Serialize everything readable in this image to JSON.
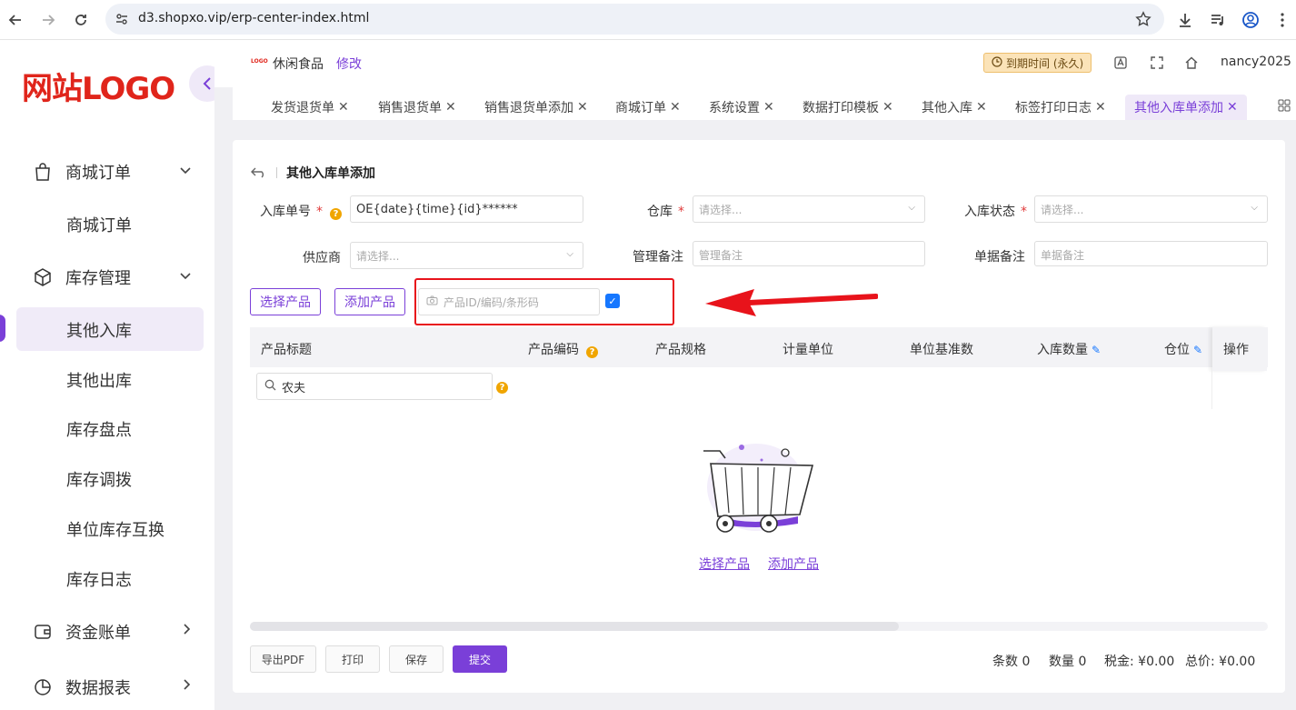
{
  "browser": {
    "url": "d3.shopxo.vip/erp-center-index.html"
  },
  "sidebar": {
    "logo": "网站LOGO",
    "groups": [
      {
        "label": "商城订单",
        "icon": "shopping-bag-icon"
      },
      {
        "label": "库存管理",
        "icon": "cube-icon"
      },
      {
        "label": "资金账单",
        "icon": "wallet-icon"
      },
      {
        "label": "数据报表",
        "icon": "pie-chart-icon"
      }
    ],
    "items": [
      "商城订单",
      "其他入库",
      "其他出库",
      "库存盘点",
      "库存调拨",
      "单位库存互换",
      "库存日志"
    ]
  },
  "header": {
    "logo_text": "LOGO",
    "shop_name": "休闲食品",
    "edit_label": "修改",
    "expire_label": "到期时间 (永久)",
    "user": "nancy2025"
  },
  "tabs": [
    {
      "label": "发货退货单"
    },
    {
      "label": "销售退货单"
    },
    {
      "label": "销售退货单添加"
    },
    {
      "label": "商城订单"
    },
    {
      "label": "系统设置"
    },
    {
      "label": "数据打印模板"
    },
    {
      "label": "其他入库"
    },
    {
      "label": "标签打印日志"
    },
    {
      "label": "其他入库单添加"
    }
  ],
  "form": {
    "title": "其他入库单添加",
    "order_no_label": "入库单号",
    "order_no_value": "OE{date}{time}{id}******",
    "warehouse_label": "仓库",
    "warehouse_placeholder": "请选择...",
    "status_label": "入库状态",
    "status_placeholder": "请选择...",
    "supplier_label": "供应商",
    "supplier_placeholder": "请选择...",
    "manage_note_label": "管理备注",
    "manage_note_placeholder": "管理备注",
    "doc_note_label": "单据备注",
    "doc_note_placeholder": "单据备注",
    "select_product": "选择产品",
    "add_product": "添加产品",
    "scan_placeholder": "产品ID/编码/条形码",
    "checkbox_checked": true
  },
  "table": {
    "columns": [
      "产品标题",
      "产品编码",
      "产品规格",
      "计量单位",
      "单位基准数",
      "入库数量",
      "仓位",
      "操作"
    ],
    "search_value": "农夫"
  },
  "empty": {
    "select_link": "选择产品",
    "add_link": "添加产品"
  },
  "footer": {
    "export_pdf": "导出PDF",
    "print": "打印",
    "save": "保存",
    "submit": "提交",
    "count_label": "条数",
    "count_value": "0",
    "qty_label": "数量",
    "qty_value": "0",
    "tax_label": "税金:",
    "tax_value": "¥0.00",
    "total_label": "总价:",
    "total_value": "¥0.00"
  },
  "colors": {
    "primary": "#7a3fd8",
    "logo_red": "#e0251b",
    "highlight_red": "#e8131b",
    "checkbox_blue": "#1677ff"
  }
}
